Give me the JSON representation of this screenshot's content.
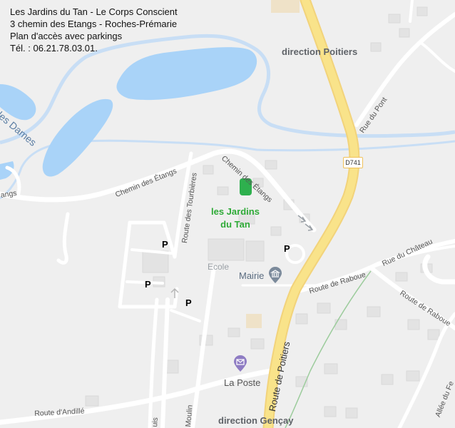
{
  "info": {
    "line1": "Les Jardins du Tan - Le Corps Conscient",
    "line2": "3 chemin des Etangs - Roches-Prémarie",
    "line3": "Plan d'accès avec parkings",
    "line4": "Tél. : 06.21.78.03.01."
  },
  "directions": {
    "north": "direction Poitiers",
    "south": "direction Gençay"
  },
  "destination": {
    "line1": "les Jardins",
    "line2": "du Tan"
  },
  "road_badge": "D741",
  "streets": {
    "des_dames": "des Dames",
    "etangs_left": "angs",
    "chemin_etangs_w": "Chemin des Étangs",
    "chemin_etangs_e": "Chemin des Étangs",
    "rue_du_pont": "Rue du Pont",
    "route_tourbieres": "Route des Tourbières",
    "rue_du_chateau": "Rue du Château",
    "route_raboue_1": "Route de Raboue",
    "route_raboue_2": "Route de Raboue",
    "route_poitiers": "Route de Poitiers",
    "route_andille": "Route d'Andillé",
    "allee_fe": "Allée du Fe",
    "moulin": "Moulin",
    "uis": "uis"
  },
  "pois": {
    "ecole": "Ecole",
    "mairie": "Mairie",
    "la_poste": "La Poste"
  },
  "parking_label": "P",
  "icons": {
    "mairie": "landmark-icon",
    "poste": "mail-icon",
    "marker": "location-marker-icon"
  },
  "colors": {
    "background": "#efefef",
    "water": "#a9d3f8",
    "highway": "#f9e38a",
    "destination": "#2eaa37"
  }
}
